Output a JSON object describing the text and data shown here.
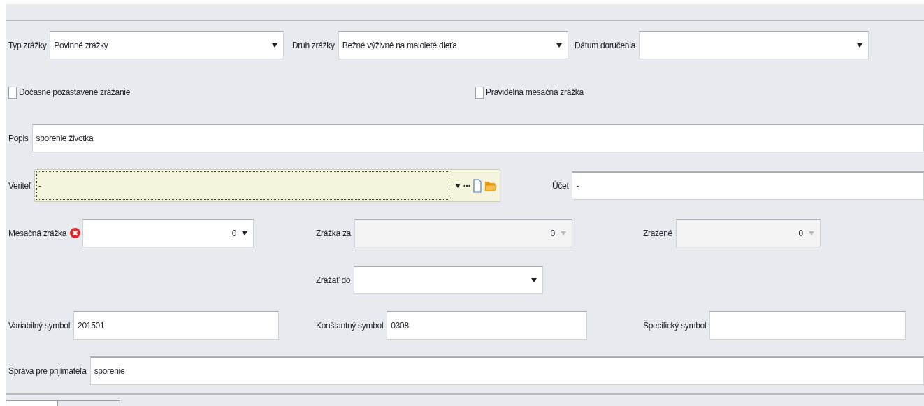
{
  "top_row": [
    {
      "label": "Typ zrážky",
      "value": "Povinné zrážky"
    },
    {
      "label": "Druh zrážky",
      "value": "Bežné výživné na maloleté dieťa"
    },
    {
      "label": "Dátum doručenia"
    }
  ],
  "checkboxes": [
    {
      "label": "Dočasne pozastavené zrážanie",
      "checked": false
    },
    {
      "label": "Pravidelná mesačná zrážka",
      "checked": false
    }
  ],
  "description": {
    "label": "Popis",
    "value": "sporenie životka"
  },
  "creditor": {
    "label": "Veriteľ",
    "value": "-"
  },
  "account": {
    "label": "Účet",
    "value": "-"
  },
  "amounts": [
    {
      "label": "Mesačná zrážka",
      "value": "0",
      "error": true,
      "disabled": false
    },
    {
      "label": "Zrážka za",
      "value": "0",
      "error": false,
      "disabled": true
    },
    {
      "label": "Zrazené",
      "value": "0",
      "error": false,
      "disabled": true
    }
  ],
  "deduct_until": {
    "label": "Zrážať do"
  },
  "symbols": [
    {
      "label": "Variabilný symbol",
      "value": "201501"
    },
    {
      "label": "Konštantný symbol",
      "value": "0308"
    },
    {
      "label": "Špecifický symbol"
    }
  ],
  "message": {
    "label": "Správa pre prijímateľa",
    "value": "sporenie"
  }
}
